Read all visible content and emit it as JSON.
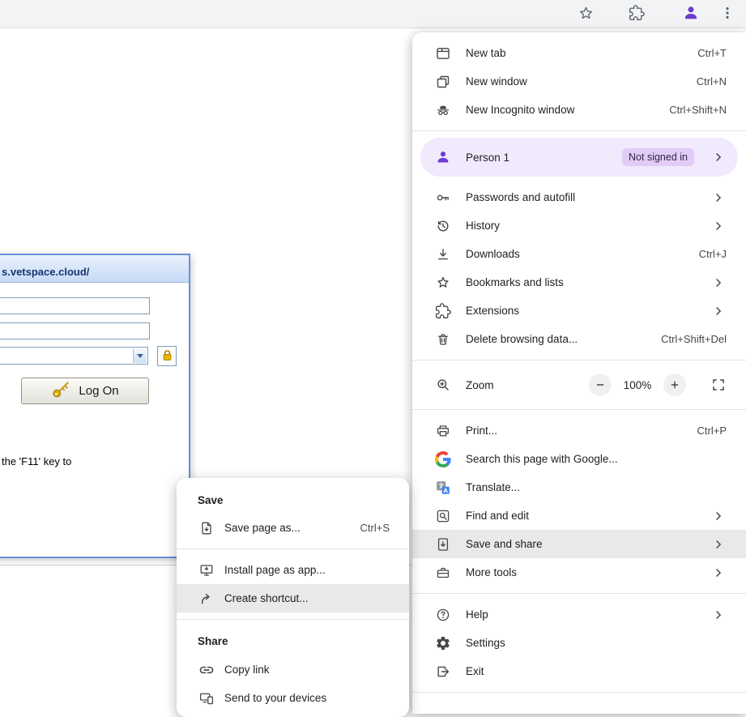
{
  "colors": {
    "accent_purple": "#6d3bd0",
    "profile_row_bg": "#f1e9fc",
    "badge_bg": "#e2cbf7",
    "hover_bg": "#e9e8ea",
    "toolbar_bg": "#f2f3f4",
    "dialog_frame": "#6a8fd8",
    "dialog_title_text": "#16366e",
    "text_primary": "#1f1f1f",
    "text_secondary": "#474747",
    "google_blue": "#4285F4",
    "google_green": "#34A853",
    "google_yellow": "#FBBC05",
    "google_red": "#EA4335",
    "gold": "#e8b400"
  },
  "page": {
    "dialog": {
      "title": "s.vetspace.cloud/",
      "log_on_label": "Log On",
      "hint_text": "the 'F11' key to"
    }
  },
  "main_menu": {
    "new_tab": {
      "label": "New tab",
      "shortcut": "Ctrl+T"
    },
    "new_window": {
      "label": "New window",
      "shortcut": "Ctrl+N"
    },
    "new_incognito": {
      "label": "New Incognito window",
      "shortcut": "Ctrl+Shift+N"
    },
    "profile": {
      "label": "Person 1",
      "status": "Not signed in"
    },
    "passwords": {
      "label": "Passwords and autofill"
    },
    "history": {
      "label": "History"
    },
    "downloads": {
      "label": "Downloads",
      "shortcut": "Ctrl+J"
    },
    "bookmarks": {
      "label": "Bookmarks and lists"
    },
    "extensions": {
      "label": "Extensions"
    },
    "delete_data": {
      "label": "Delete browsing data...",
      "shortcut": "Ctrl+Shift+Del"
    },
    "zoom": {
      "label": "Zoom",
      "value": "100%"
    },
    "print": {
      "label": "Print...",
      "shortcut": "Ctrl+P"
    },
    "search_google": {
      "label": "Search this page with Google..."
    },
    "translate": {
      "label": "Translate..."
    },
    "find_edit": {
      "label": "Find and edit"
    },
    "save_share": {
      "label": "Save and share"
    },
    "more_tools": {
      "label": "More tools"
    },
    "help": {
      "label": "Help"
    },
    "settings": {
      "label": "Settings"
    },
    "exit": {
      "label": "Exit"
    }
  },
  "submenu": {
    "save_header": "Save",
    "save_page_as": {
      "label": "Save page as...",
      "shortcut": "Ctrl+S"
    },
    "install_app": {
      "label": "Install page as app..."
    },
    "create_shortcut": {
      "label": "Create shortcut..."
    },
    "share_header": "Share",
    "copy_link": {
      "label": "Copy link"
    },
    "send_devices": {
      "label": "Send to your devices"
    }
  }
}
